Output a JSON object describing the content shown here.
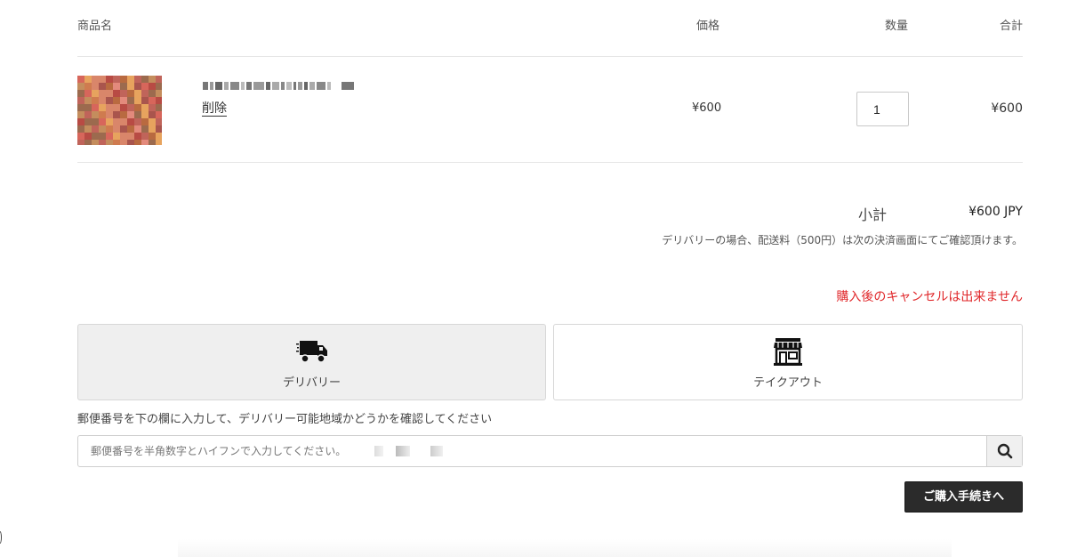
{
  "table_header": {
    "product": "商品名",
    "price": "価格",
    "quantity": "数量",
    "total": "合計"
  },
  "item": {
    "image_icon": "product-photo-pixelated",
    "remove_label": "削除",
    "price": "¥600",
    "quantity": "1",
    "total": "¥600"
  },
  "summary": {
    "subtotal_label": "小計",
    "subtotal_value": "¥600 JPY",
    "shipping_note": "デリバリーの場合、配送料（500円）は次の決済画面にてご確認頂けます。",
    "cancel_note": "購入後のキャンセルは出来ません",
    "cancel_color": "#e0272a"
  },
  "methods": {
    "delivery": {
      "label": "デリバリー",
      "icon": "truck-icon",
      "selected": true
    },
    "takeout": {
      "label": "テイクアウト",
      "icon": "storefront-icon",
      "selected": false
    }
  },
  "zip": {
    "hint": "郵便番号を下の欄に入力して、デリバリー可能地域かどうかを確認してください",
    "placeholder": "郵便番号を半角数字とハイフンで入力してください。",
    "search_icon": "search-icon"
  },
  "checkout": {
    "label": "ご購入手続きへ",
    "color": "#2b2b2b"
  }
}
